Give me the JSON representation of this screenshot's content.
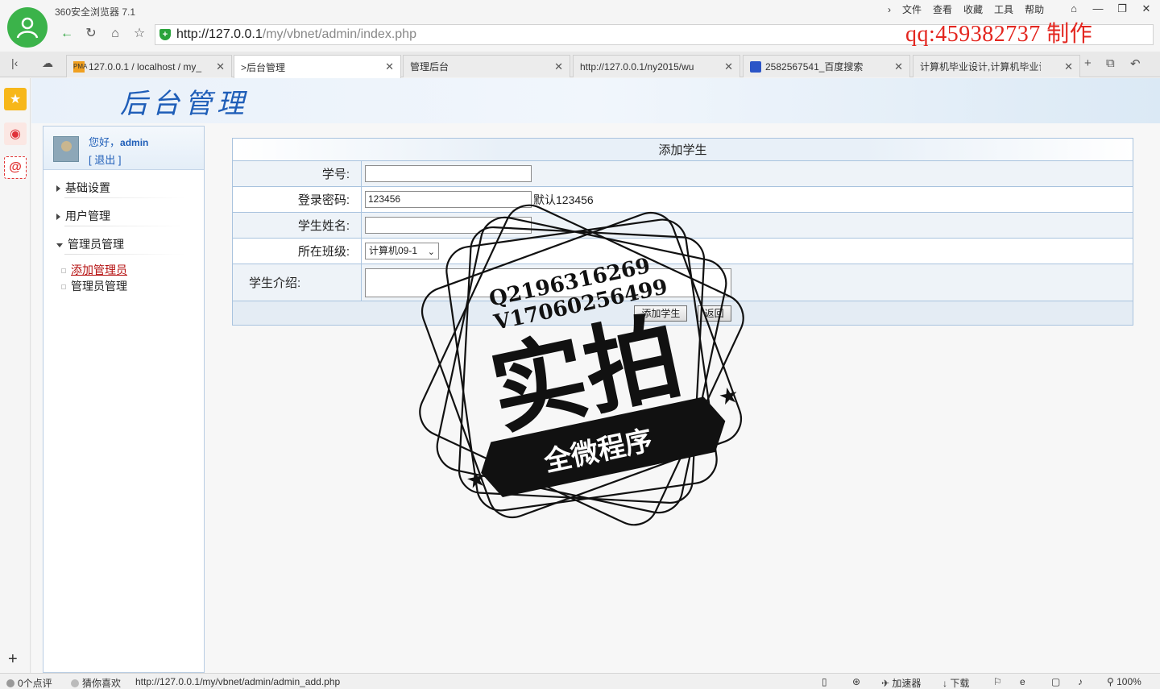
{
  "browser": {
    "app_title": "360安全浏览器 7.1",
    "menu": [
      "文件",
      "查看",
      "收藏",
      "工具",
      "帮助"
    ],
    "address_host": "http://127.0.0.1",
    "address_path": "/my/vbnet/admin/index.php",
    "overlay_text": "qq:459382737  制作",
    "tabs": [
      {
        "label": "127.0.0.1 / localhost / my_",
        "icon": "pma-icon",
        "active": false
      },
      {
        "label": ">后台管理",
        "icon": "page-icon",
        "active": true
      },
      {
        "label": "管理后台",
        "icon": "page-icon",
        "active": false
      },
      {
        "label": "http://127.0.0.1/ny2015/wu",
        "icon": "page-icon",
        "active": false
      },
      {
        "label": "2582567541_百度搜索",
        "icon": "baidu-paw-icon",
        "active": false
      },
      {
        "label": "计算机毕业设计,计算机毕业设",
        "icon": "page-icon",
        "active": false
      }
    ]
  },
  "page": {
    "banner_title": "后台管理",
    "user": {
      "greeting": "您好，",
      "name": "admin",
      "logout": "[ 退出 ]"
    },
    "menu_groups": [
      {
        "label": "基础设置",
        "expanded": false
      },
      {
        "label": "用户管理",
        "expanded": false
      },
      {
        "label": "管理员管理",
        "expanded": true
      }
    ],
    "menu_subitems": [
      {
        "label": "添加管理员",
        "active": true
      },
      {
        "label": "管理员管理",
        "active": false
      }
    ],
    "form": {
      "title": "添加学生",
      "fields": {
        "student_id_label": "学号:",
        "password_label": "登录密码:",
        "password_value": "123456",
        "password_hint": "默认123456",
        "name_label": "学生姓名:",
        "class_label": "所在班级:",
        "class_value": "计算机09-1",
        "intro_label": "学生介绍:"
      },
      "submit_label": "添加学生",
      "back_label": "返回"
    }
  },
  "stamp": {
    "line1": "Q2196316269",
    "line2": "V17060256499",
    "big": "实拍",
    "ribbon": "全微程序"
  },
  "statusbar": {
    "reviews": "0个点评",
    "guess": "猜你喜欢",
    "url": "http://127.0.0.1/my/vbnet/admin/admin_add.php",
    "accelerator": "加速器",
    "download": "下载",
    "zoom": "100%"
  }
}
